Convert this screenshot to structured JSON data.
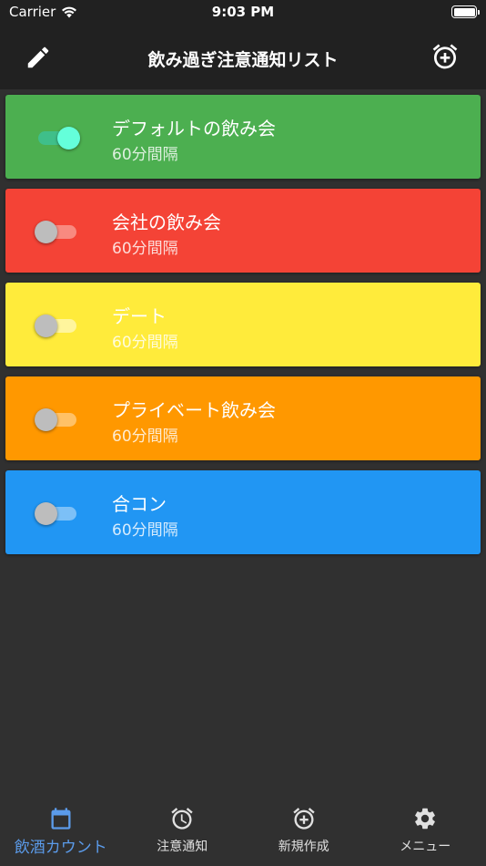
{
  "status_bar": {
    "carrier": "Carrier",
    "time": "9:03 PM"
  },
  "app_bar": {
    "title": "飲み過ぎ注意通知リスト",
    "icons": {
      "left": "edit-icon",
      "right": "alarm-add-icon"
    }
  },
  "list": {
    "items": [
      {
        "title": "デフォルトの飲み会",
        "subtitle": "60分間隔",
        "enabled": true,
        "color": "#4caf50",
        "track_color": "#3fbf8a",
        "thumb_color": "#64ffda"
      },
      {
        "title": "会社の飲み会",
        "subtitle": "60分間隔",
        "enabled": false,
        "color": "#f44336",
        "track_color": "#f88a80",
        "thumb_color": "#bdbdbd"
      },
      {
        "title": "デート",
        "subtitle": "60分間隔",
        "enabled": false,
        "color": "#ffeb3b",
        "track_color": "#fff59d",
        "thumb_color": "#bdbdbd"
      },
      {
        "title": "プライベート飲み会",
        "subtitle": "60分間隔",
        "enabled": false,
        "color": "#ff9800",
        "track_color": "#ffc166",
        "thumb_color": "#bdbdbd"
      },
      {
        "title": "合コン",
        "subtitle": "60分間隔",
        "enabled": false,
        "color": "#2196f3",
        "track_color": "#7cc0f7",
        "thumb_color": "#bdbdbd"
      }
    ]
  },
  "bottom_nav": {
    "active_color": "#5b9bea",
    "items": [
      {
        "label": "飲酒カウント",
        "icon": "calendar-icon",
        "active": true
      },
      {
        "label": "注意通知",
        "icon": "alarm-icon",
        "active": false
      },
      {
        "label": "新規作成",
        "icon": "alarm-add-icon",
        "active": false
      },
      {
        "label": "メニュー",
        "icon": "gear-icon",
        "active": false
      }
    ]
  }
}
